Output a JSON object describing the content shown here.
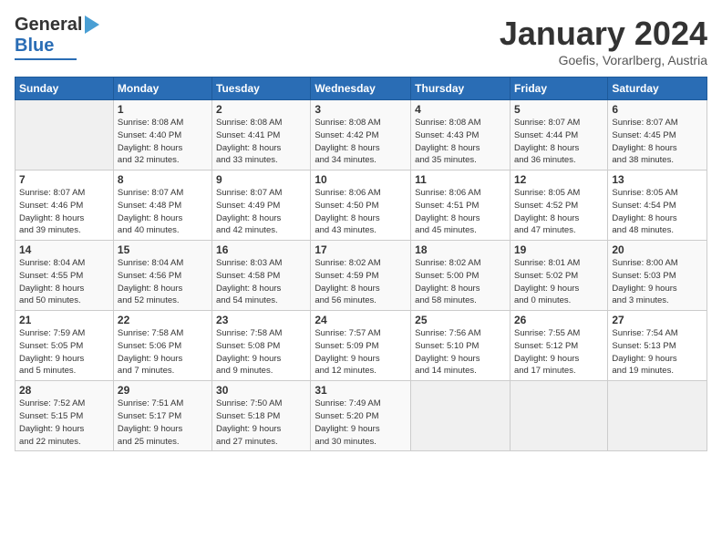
{
  "header": {
    "logo_line1": "General",
    "logo_line2": "Blue",
    "month": "January 2024",
    "location": "Goefis, Vorarlberg, Austria"
  },
  "days_header": [
    "Sunday",
    "Monday",
    "Tuesday",
    "Wednesday",
    "Thursday",
    "Friday",
    "Saturday"
  ],
  "weeks": [
    [
      {
        "day": "",
        "info": ""
      },
      {
        "day": "1",
        "info": "Sunrise: 8:08 AM\nSunset: 4:40 PM\nDaylight: 8 hours\nand 32 minutes."
      },
      {
        "day": "2",
        "info": "Sunrise: 8:08 AM\nSunset: 4:41 PM\nDaylight: 8 hours\nand 33 minutes."
      },
      {
        "day": "3",
        "info": "Sunrise: 8:08 AM\nSunset: 4:42 PM\nDaylight: 8 hours\nand 34 minutes."
      },
      {
        "day": "4",
        "info": "Sunrise: 8:08 AM\nSunset: 4:43 PM\nDaylight: 8 hours\nand 35 minutes."
      },
      {
        "day": "5",
        "info": "Sunrise: 8:07 AM\nSunset: 4:44 PM\nDaylight: 8 hours\nand 36 minutes."
      },
      {
        "day": "6",
        "info": "Sunrise: 8:07 AM\nSunset: 4:45 PM\nDaylight: 8 hours\nand 38 minutes."
      }
    ],
    [
      {
        "day": "7",
        "info": "Sunrise: 8:07 AM\nSunset: 4:46 PM\nDaylight: 8 hours\nand 39 minutes."
      },
      {
        "day": "8",
        "info": "Sunrise: 8:07 AM\nSunset: 4:48 PM\nDaylight: 8 hours\nand 40 minutes."
      },
      {
        "day": "9",
        "info": "Sunrise: 8:07 AM\nSunset: 4:49 PM\nDaylight: 8 hours\nand 42 minutes."
      },
      {
        "day": "10",
        "info": "Sunrise: 8:06 AM\nSunset: 4:50 PM\nDaylight: 8 hours\nand 43 minutes."
      },
      {
        "day": "11",
        "info": "Sunrise: 8:06 AM\nSunset: 4:51 PM\nDaylight: 8 hours\nand 45 minutes."
      },
      {
        "day": "12",
        "info": "Sunrise: 8:05 AM\nSunset: 4:52 PM\nDaylight: 8 hours\nand 47 minutes."
      },
      {
        "day": "13",
        "info": "Sunrise: 8:05 AM\nSunset: 4:54 PM\nDaylight: 8 hours\nand 48 minutes."
      }
    ],
    [
      {
        "day": "14",
        "info": "Sunrise: 8:04 AM\nSunset: 4:55 PM\nDaylight: 8 hours\nand 50 minutes."
      },
      {
        "day": "15",
        "info": "Sunrise: 8:04 AM\nSunset: 4:56 PM\nDaylight: 8 hours\nand 52 minutes."
      },
      {
        "day": "16",
        "info": "Sunrise: 8:03 AM\nSunset: 4:58 PM\nDaylight: 8 hours\nand 54 minutes."
      },
      {
        "day": "17",
        "info": "Sunrise: 8:02 AM\nSunset: 4:59 PM\nDaylight: 8 hours\nand 56 minutes."
      },
      {
        "day": "18",
        "info": "Sunrise: 8:02 AM\nSunset: 5:00 PM\nDaylight: 8 hours\nand 58 minutes."
      },
      {
        "day": "19",
        "info": "Sunrise: 8:01 AM\nSunset: 5:02 PM\nDaylight: 9 hours\nand 0 minutes."
      },
      {
        "day": "20",
        "info": "Sunrise: 8:00 AM\nSunset: 5:03 PM\nDaylight: 9 hours\nand 3 minutes."
      }
    ],
    [
      {
        "day": "21",
        "info": "Sunrise: 7:59 AM\nSunset: 5:05 PM\nDaylight: 9 hours\nand 5 minutes."
      },
      {
        "day": "22",
        "info": "Sunrise: 7:58 AM\nSunset: 5:06 PM\nDaylight: 9 hours\nand 7 minutes."
      },
      {
        "day": "23",
        "info": "Sunrise: 7:58 AM\nSunset: 5:08 PM\nDaylight: 9 hours\nand 9 minutes."
      },
      {
        "day": "24",
        "info": "Sunrise: 7:57 AM\nSunset: 5:09 PM\nDaylight: 9 hours\nand 12 minutes."
      },
      {
        "day": "25",
        "info": "Sunrise: 7:56 AM\nSunset: 5:10 PM\nDaylight: 9 hours\nand 14 minutes."
      },
      {
        "day": "26",
        "info": "Sunrise: 7:55 AM\nSunset: 5:12 PM\nDaylight: 9 hours\nand 17 minutes."
      },
      {
        "day": "27",
        "info": "Sunrise: 7:54 AM\nSunset: 5:13 PM\nDaylight: 9 hours\nand 19 minutes."
      }
    ],
    [
      {
        "day": "28",
        "info": "Sunrise: 7:52 AM\nSunset: 5:15 PM\nDaylight: 9 hours\nand 22 minutes."
      },
      {
        "day": "29",
        "info": "Sunrise: 7:51 AM\nSunset: 5:17 PM\nDaylight: 9 hours\nand 25 minutes."
      },
      {
        "day": "30",
        "info": "Sunrise: 7:50 AM\nSunset: 5:18 PM\nDaylight: 9 hours\nand 27 minutes."
      },
      {
        "day": "31",
        "info": "Sunrise: 7:49 AM\nSunset: 5:20 PM\nDaylight: 9 hours\nand 30 minutes."
      },
      {
        "day": "",
        "info": ""
      },
      {
        "day": "",
        "info": ""
      },
      {
        "day": "",
        "info": ""
      }
    ]
  ]
}
